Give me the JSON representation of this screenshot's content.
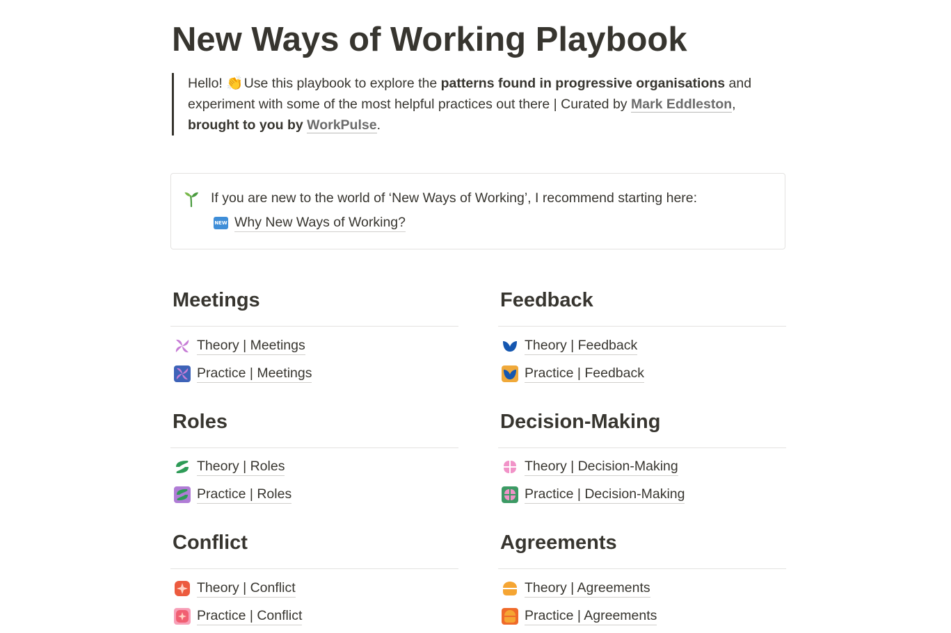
{
  "page": {
    "title": "New Ways of Working Playbook"
  },
  "intro": {
    "text1": "Hello! ",
    "emoji": "👏",
    "text2": " Use this playbook to explore the ",
    "bold1": "patterns found in progressive organisations",
    "text3": " and experiment with some of the most helpful practices out there | Curated by ",
    "author_link": "Mark Eddleston",
    "text4": ", ",
    "bold2": "brought to you by",
    "text5": " ",
    "brand_link": "WorkPulse",
    "text6": "."
  },
  "callout": {
    "icon": "seedling-icon",
    "text": "If you are new to the world of ‘New Ways of Working’, I recommend starting here:",
    "link_icon_label": "NEW",
    "link_label": "Why New Ways of Working?"
  },
  "sections": [
    {
      "heading": "Meetings",
      "items": [
        {
          "label": "Theory | Meetings",
          "icon": "pinwheel-icon",
          "color": "#c77dd6"
        },
        {
          "label": "Practice | Meetings",
          "icon": "pinwheel-tile-icon",
          "color": "#3e63b8"
        }
      ]
    },
    {
      "heading": "Feedback",
      "items": [
        {
          "label": "Theory | Feedback",
          "icon": "butterfly-icon",
          "color": "#1557b0"
        },
        {
          "label": "Practice | Feedback",
          "icon": "butterfly-tile-icon",
          "color": "#f0a93a"
        }
      ]
    },
    {
      "heading": "Roles",
      "items": [
        {
          "label": "Theory | Roles",
          "icon": "leaf-icon",
          "color": "#2e9b57"
        },
        {
          "label": "Practice | Roles",
          "icon": "leaf-tile-icon",
          "color": "#b07cd6"
        }
      ]
    },
    {
      "heading": "Decision-Making",
      "items": [
        {
          "label": "Theory | Decision-Making",
          "icon": "petals-icon",
          "color": "#f193c8"
        },
        {
          "label": "Practice | Decision-Making",
          "icon": "petals-tile-icon",
          "color": "#3c9a64"
        }
      ]
    },
    {
      "heading": "Conflict",
      "items": [
        {
          "label": "Theory | Conflict",
          "icon": "spark-icon",
          "color": "#ec5b3f"
        },
        {
          "label": "Practice | Conflict",
          "icon": "spark-tile-icon",
          "color": "#f15f72"
        }
      ]
    },
    {
      "heading": "Agreements",
      "items": [
        {
          "label": "Theory | Agreements",
          "icon": "dome-icon",
          "color": "#f5a533"
        },
        {
          "label": "Practice | Agreements",
          "icon": "dome-tile-icon",
          "color": "#ef6a2a"
        }
      ]
    }
  ]
}
